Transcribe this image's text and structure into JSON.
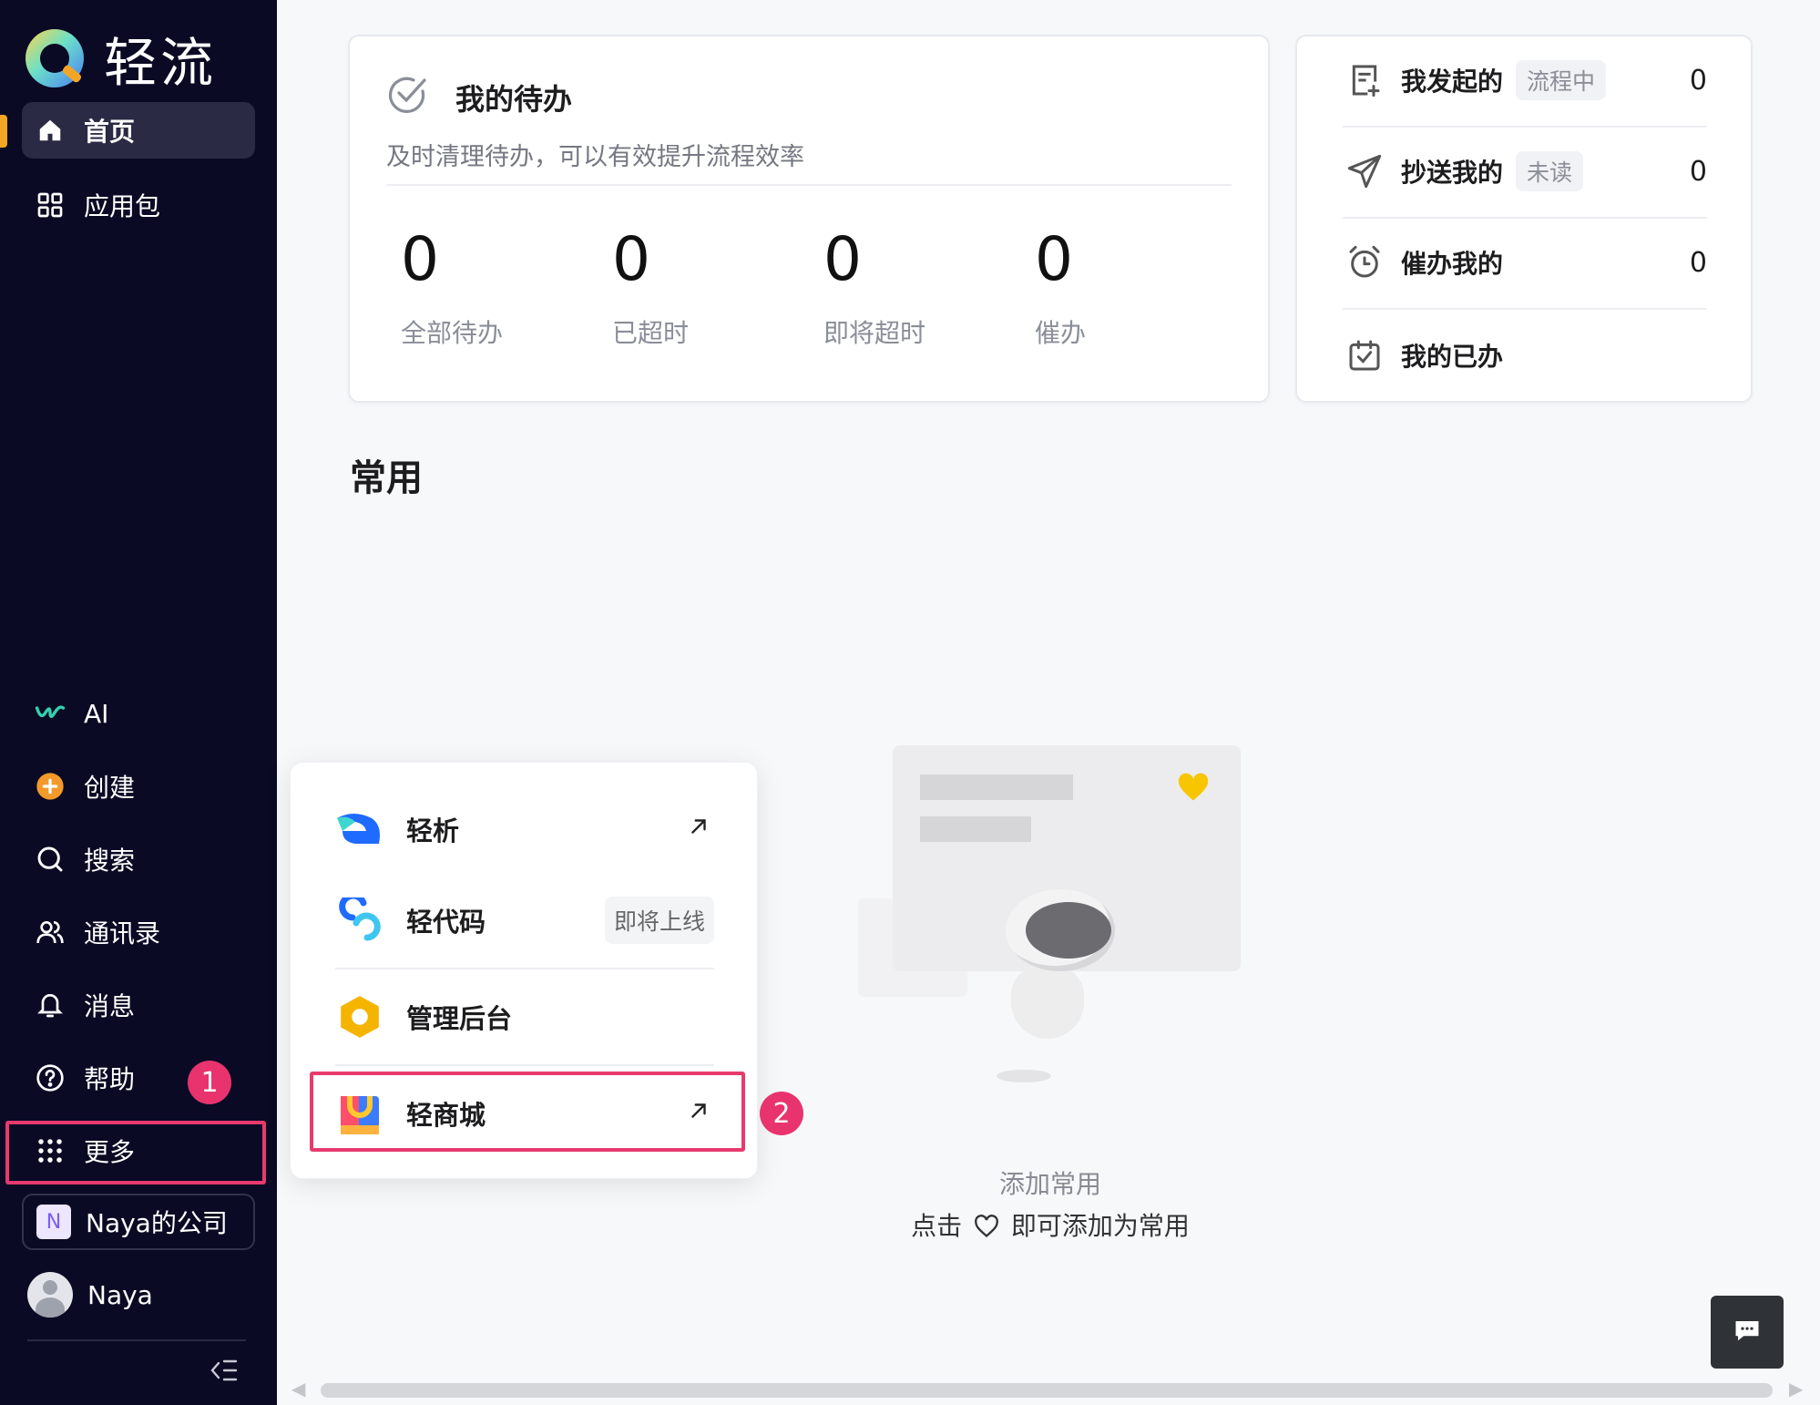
{
  "app": {
    "name": "轻流"
  },
  "sidebar": {
    "home": "首页",
    "apps": "应用包",
    "ai": "AI",
    "create": "创建",
    "search": "搜索",
    "contacts": "通讯录",
    "messages": "消息",
    "help": "帮助",
    "more": "更多",
    "company_initial": "N",
    "company": "Naya的公司",
    "user": "Naya"
  },
  "annotations": {
    "step1": "1",
    "step2": "2"
  },
  "todo": {
    "title": "我的待办",
    "subtitle": "及时清理待办，可以有效提升流程效率",
    "stats": [
      {
        "value": "0",
        "label": "全部待办"
      },
      {
        "value": "0",
        "label": "已超时"
      },
      {
        "value": "0",
        "label": "即将超时"
      },
      {
        "value": "0",
        "label": "催办"
      }
    ]
  },
  "right_panel": {
    "rows": [
      {
        "label": "我发起的",
        "tag": "流程中",
        "count": "0"
      },
      {
        "label": "抄送我的",
        "tag": "未读",
        "count": "0"
      },
      {
        "label": "催办我的",
        "tag": "",
        "count": "0"
      },
      {
        "label": "我的已办",
        "tag": "",
        "count": ""
      }
    ]
  },
  "frequent": {
    "title": "常用"
  },
  "popover": {
    "items": [
      {
        "label": "轻析",
        "tag": ""
      },
      {
        "label": "轻代码",
        "tag": "即将上线"
      },
      {
        "label": "管理后台",
        "tag": ""
      },
      {
        "label": "轻商城",
        "tag": ""
      }
    ]
  },
  "empty_state": {
    "title": "添加常用",
    "hint_prefix": "点击",
    "hint_suffix": "即可添加为常用"
  },
  "colors": {
    "sidebar_bg": "#0a0a24",
    "accent": "#f5a524",
    "annotation": "#e8336e"
  }
}
